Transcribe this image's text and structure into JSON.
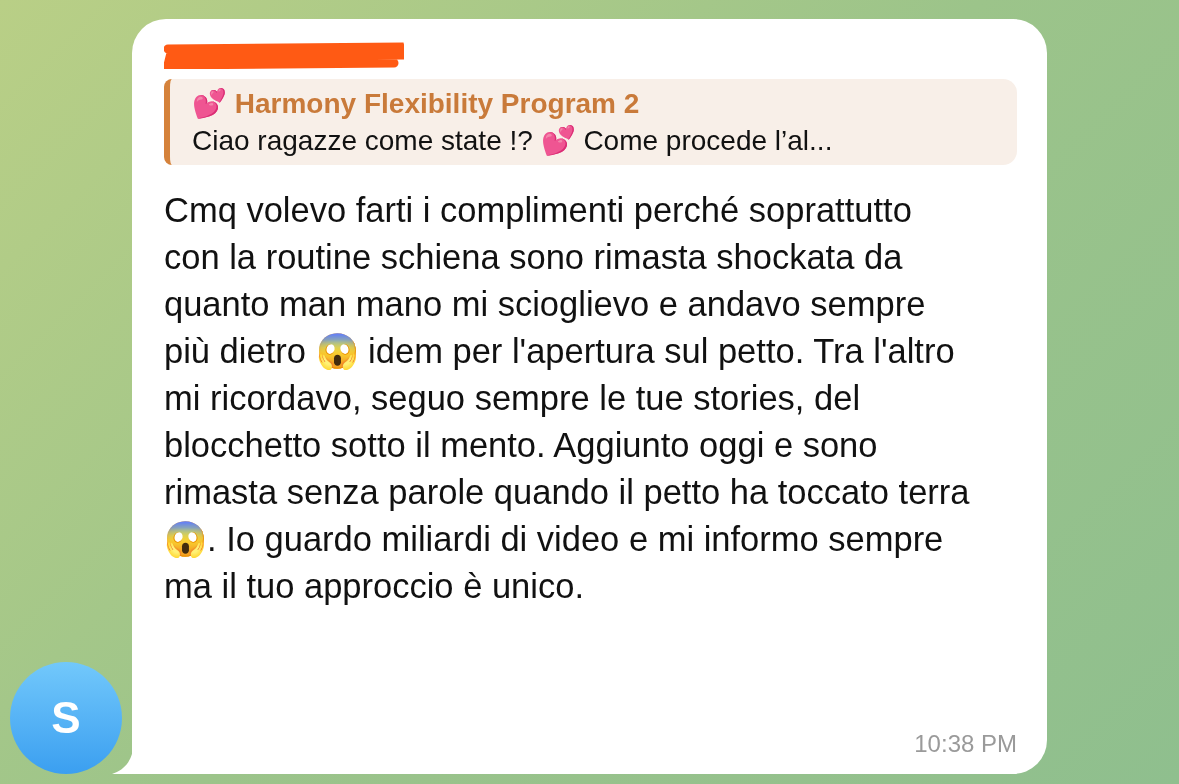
{
  "message": {
    "avatar_letter": "S",
    "reply": {
      "title": "💕 Harmony Flexibility Program 2",
      "text": "Ciao ragazze come state !? 💕  Come procede l’al..."
    },
    "text": "Cmq volevo farti i complimenti perché soprattutto con la routine schiena sono rimasta shockata da quanto man mano mi scioglievo e andavo sempre più dietro 😱 idem per l'apertura sul petto. Tra l'altro mi ricordavo, seguo sempre le tue stories, del blocchetto sotto il mento. Aggiunto oggi e sono rimasta senza parole quando il petto ha toccato terra 😱. Io guardo miliardi di video e mi informo sempre ma il tuo approccio è unico.",
    "time": "10:38 PM"
  }
}
